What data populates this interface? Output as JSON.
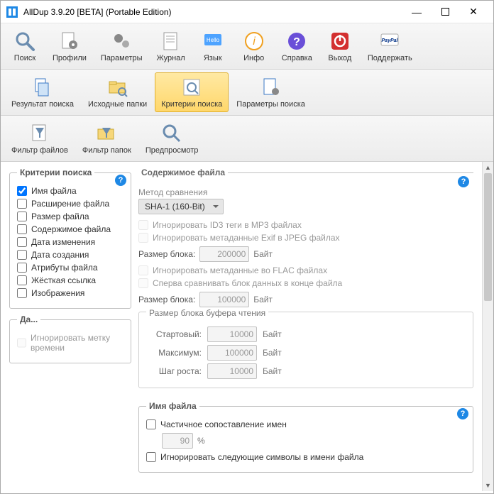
{
  "window": {
    "title": "AllDup 3.9.20 [BETA] (Portable Edition)"
  },
  "toolbar": [
    {
      "label": "Поиск",
      "icon": "magnifier"
    },
    {
      "label": "Профили",
      "icon": "gear-doc"
    },
    {
      "label": "Параметры",
      "icon": "gears"
    },
    {
      "label": "Журнал",
      "icon": "log"
    },
    {
      "label": "Язык",
      "icon": "hello"
    },
    {
      "label": "Инфо",
      "icon": "info"
    },
    {
      "label": "Справка",
      "icon": "help"
    },
    {
      "label": "Выход",
      "icon": "power"
    },
    {
      "label": "Поддержать",
      "icon": "paypal"
    }
  ],
  "tabs": [
    {
      "label": "Результат поиска",
      "icon": "result",
      "selected": false
    },
    {
      "label": "Исходные папки",
      "icon": "folders",
      "selected": false
    },
    {
      "label": "Критерии поиска",
      "icon": "criteria",
      "selected": true
    },
    {
      "label": "Параметры поиска",
      "icon": "params",
      "selected": false
    }
  ],
  "tabs2": [
    {
      "label": "Фильтр файлов",
      "icon": "filter"
    },
    {
      "label": "Фильтр папок",
      "icon": "filter-folder"
    },
    {
      "label": "Предпросмотр",
      "icon": "preview"
    }
  ],
  "criteria": {
    "legend": "Критерии поиска",
    "items": [
      {
        "label": "Имя файла",
        "checked": true
      },
      {
        "label": "Расширение файла",
        "checked": false
      },
      {
        "label": "Размер файла",
        "checked": false
      },
      {
        "label": "Содержимое файла",
        "checked": false
      },
      {
        "label": "Дата изменения",
        "checked": false
      },
      {
        "label": "Дата создания",
        "checked": false
      },
      {
        "label": "Атрибуты файла",
        "checked": false
      },
      {
        "label": "Жёсткая ссылка",
        "checked": false
      },
      {
        "label": "Изображения",
        "checked": false
      }
    ]
  },
  "date_opts": {
    "legend": "Да...",
    "ignore_timestamp": "Игнорировать метку времени"
  },
  "content": {
    "legend": "Содержимое файла",
    "method_label": "Метод сравнения",
    "method_value": "SHA-1 (160-Bit)",
    "ignore_id3": "Игнорировать ID3 теги в MP3 файлах",
    "ignore_exif": "Игнорировать метаданные Exif в JPEG файлах",
    "block1_label": "Размер блока:",
    "block1_value": "200000",
    "ignore_flac": "Игнорировать метаданные во FLAC файлах",
    "compare_end": "Сперва сравнивать блок данных в конце файла",
    "block2_label": "Размер блока:",
    "block2_value": "100000",
    "unit": "Байт",
    "buffer": {
      "legend": "Размер блока буфера чтения",
      "start_label": "Стартовый:",
      "start_value": "10000",
      "max_label": "Максимум:",
      "max_value": "100000",
      "step_label": "Шаг роста:",
      "step_value": "10000"
    }
  },
  "filename": {
    "legend": "Имя файла",
    "partial": "Частичное сопоставление имен",
    "percent_value": "90",
    "percent_unit": "%",
    "ignore_chars": "Игнорировать следующие символы в имени файла"
  }
}
